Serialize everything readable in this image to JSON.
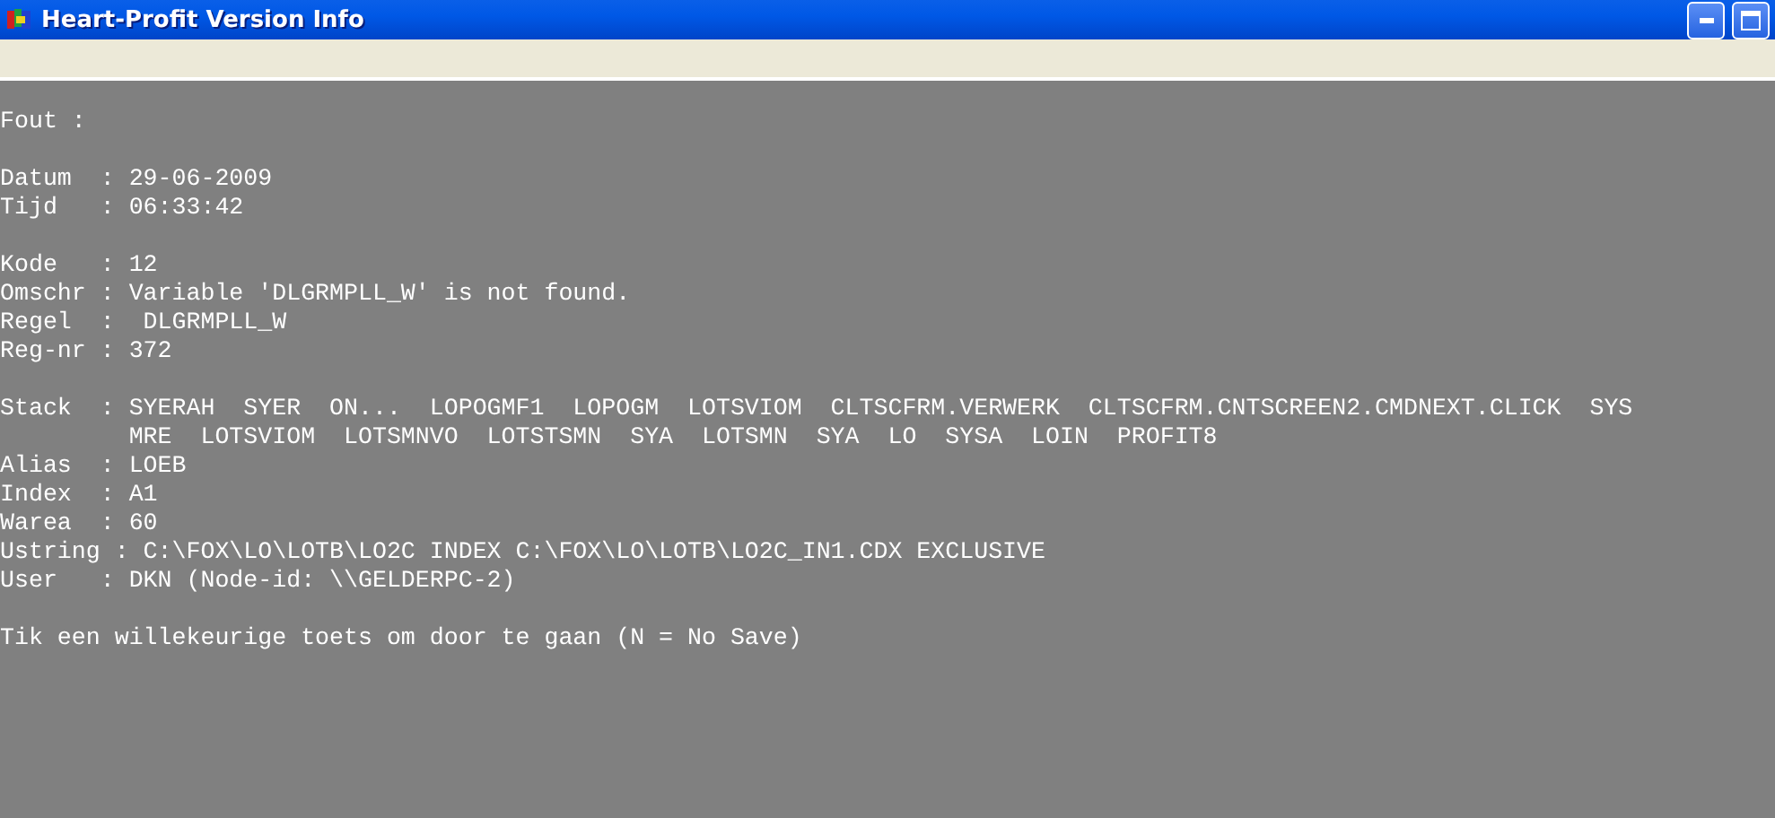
{
  "window": {
    "title": "Heart-Profit Version Info"
  },
  "blocks": [
    [
      "Fout :"
    ],
    [
      "Datum  : 29-06-2009",
      "Tijd   : 06:33:42"
    ],
    [
      "Kode   : 12",
      "Omschr : Variable 'DLGRMPLL_W' is not found.",
      "Regel  :  DLGRMPLL_W",
      "Reg-nr : 372"
    ],
    [
      "Stack  : SYERAH  SYER  ON...  LOPOGMF1  LOPOGM  LOTSVIOM  CLTSCFRM.VERWERK  CLTSCFRM.CNTSCREEN2.CMDNEXT.CLICK  SYS",
      "         MRE  LOTSVIOM  LOTSMNVO  LOTSTSMN  SYA  LOTSMN  SYA  LO  SYSA  LOIN  PROFIT8",
      "Alias  : LOEB",
      "Index  : A1",
      "Warea  : 60",
      "Ustring : C:\\FOX\\LO\\LOTB\\LO2C INDEX C:\\FOX\\LO\\LOTB\\LO2C_IN1.CDX EXCLUSIVE",
      "User   : DKN (Node-id: \\\\GELDERPC-2)"
    ],
    [
      "Tik een willekeurige toets om door te gaan (N = No Save)"
    ]
  ]
}
